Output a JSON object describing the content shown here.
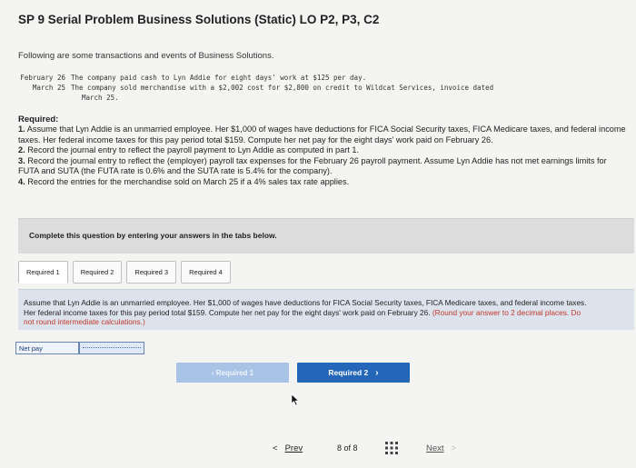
{
  "title": "SP 9 Serial Problem Business Solutions (Static) LO P2, P3, C2",
  "intro": "Following are some transactions and events of Business Solutions.",
  "transactions": [
    {
      "date": "February 26",
      "text": "The company paid cash to Lyn Addie for eight days' work at $125 per day."
    },
    {
      "date": "March 25",
      "text": "The company sold merchandise with a $2,002 cost for $2,800 on credit to Wildcat Services, invoice dated",
      "continuation": "March 25."
    }
  ],
  "required_heading": "Required:",
  "requirements": [
    {
      "num": "1.",
      "text": "Assume that Lyn Addie is an unmarried employee. Her $1,000 of wages have deductions for FICA Social Security taxes, FICA Medicare taxes, and federal income taxes. Her federal income taxes for this pay period total $159. Compute her net pay for the eight days' work paid on February 26."
    },
    {
      "num": "2.",
      "text": "Record the journal entry to reflect the payroll payment to Lyn Addie as computed in part 1."
    },
    {
      "num": "3.",
      "text": "Record the journal entry to reflect the (employer) payroll tax expenses for the February 26 payroll payment. Assume Lyn Addie has not met earnings limits for FUTA and SUTA (the FUTA rate is 0.6% and the SUTA rate is 5.4% for the company)."
    },
    {
      "num": "4.",
      "text": "Record the entries for the merchandise sold on March 25 if a 4% sales tax rate applies."
    }
  ],
  "complete_instruction": "Complete this question by entering your answers in the tabs below.",
  "tabs": [
    "Required 1",
    "Required 2",
    "Required 3",
    "Required 4"
  ],
  "active_tab": 0,
  "question": {
    "text": "Assume that Lyn Addie is an unmarried employee. Her $1,000 of wages have deductions for FICA Social Security taxes, FICA Medicare taxes, and federal income taxes. Her federal income taxes for this pay period total $159. Compute her net pay for the eight days' work paid on February 26.",
    "hint": "(Round your answer to 2 decimal places. Do not round intermediate calculations.)"
  },
  "net_pay": {
    "label": "Net pay",
    "value": ""
  },
  "nav_buttons": {
    "prev_label": "Required 1",
    "next_label": "Required 2"
  },
  "pager": {
    "prev": "Prev",
    "count": "8 of 8",
    "next": "Next"
  },
  "colors": {
    "primary_button": "#2467b8",
    "disabled_button": "#a9c3e6",
    "hint": "#c0392b"
  },
  "icons": [
    "chevron-left-icon",
    "chevron-right-icon",
    "grid-icon",
    "cursor-icon"
  ]
}
